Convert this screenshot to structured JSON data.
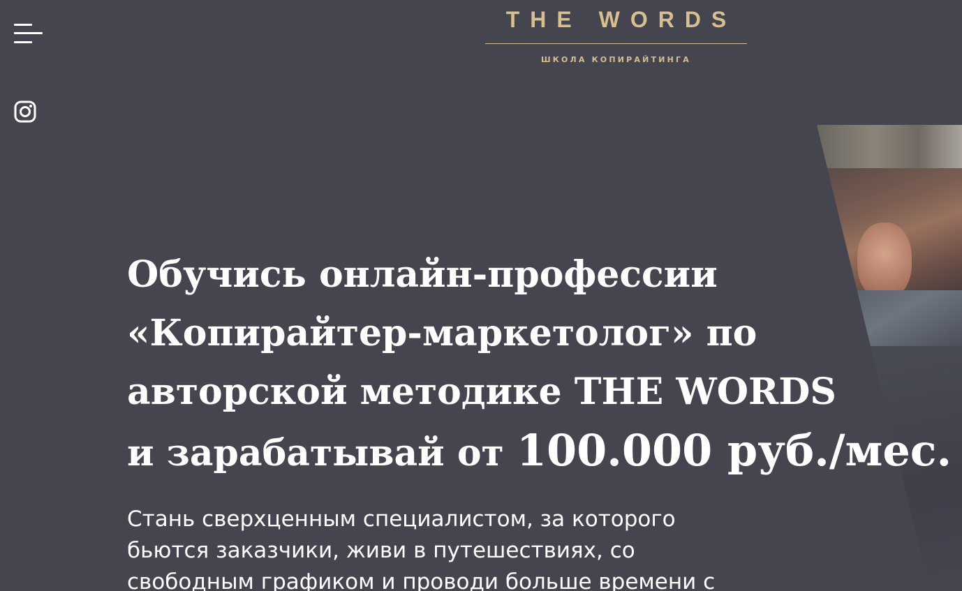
{
  "header": {
    "logo_title": "THE WORDS",
    "logo_subtitle": "ШКОЛА КОПИРАЙТИНГА",
    "menu_icon": "hamburger-menu-icon",
    "social_icon": "instagram-icon"
  },
  "hero": {
    "headline_line1": "Обучись онлайн-профессии",
    "headline_line2": "«Копирайтер-маркетолог» по",
    "headline_line3": "авторской методике THE WORDS",
    "headline_line4_prefix": "и зарабатывай от",
    "headline_line4_amount": "100.000 руб./мес.",
    "lead_line1": "Стань сверхценным специалистом, за которого",
    "lead_line2": "бьются заказчики, живи в путешествиях, со",
    "lead_line3": "свободным графиком и проводи больше времени с"
  },
  "colors": {
    "background": "#45454f",
    "accent_gold": "#d8bf8f",
    "text": "#ffffff"
  }
}
